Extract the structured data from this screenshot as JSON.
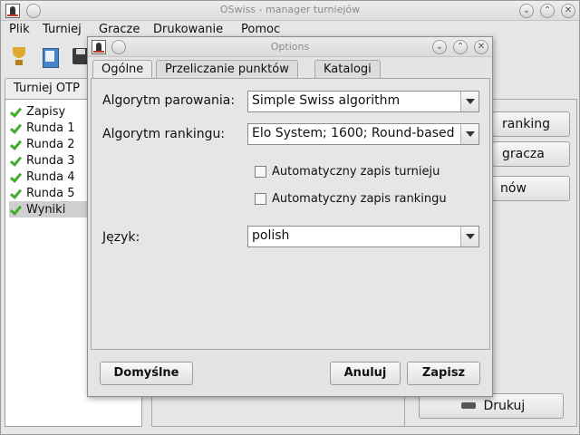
{
  "main_window": {
    "title": "OSwiss - manager turniejów",
    "menu": [
      "Plik",
      "Turniej",
      "Gracze",
      "Drukowanie",
      "Pomoc"
    ],
    "left_tab": "Turniej OTP",
    "tree_items": [
      "Zapisy",
      "Runda 1",
      "Runda 2",
      "Runda 3",
      "Runda 4",
      "Runda 5",
      "Wyniki"
    ],
    "selected_item": "Wyniki",
    "side_buttons": {
      "ranking": "ranking",
      "gracza": "gracza",
      "nows": "nów",
      "print": "Drukuj"
    }
  },
  "dialog": {
    "title": "Options",
    "tabs": [
      "Ogólne",
      "Przeliczanie punktów",
      "Katalogi"
    ],
    "active_tab": "Ogólne",
    "pairing_label": "Algorytm parowania:",
    "pairing_value": "Simple Swiss algorithm",
    "ranking_label": "Algorytm rankingu:",
    "ranking_value": "Elo System; 1600; Round-based",
    "autosave_tournament": "Automatyczny zapis turnieju",
    "autosave_ranking": "Automatyczny zapis rankingu",
    "language_label": "Język:",
    "language_value": "polish",
    "buttons": {
      "defaults": "Domyślne",
      "cancel": "Anuluj",
      "save": "Zapisz"
    }
  }
}
